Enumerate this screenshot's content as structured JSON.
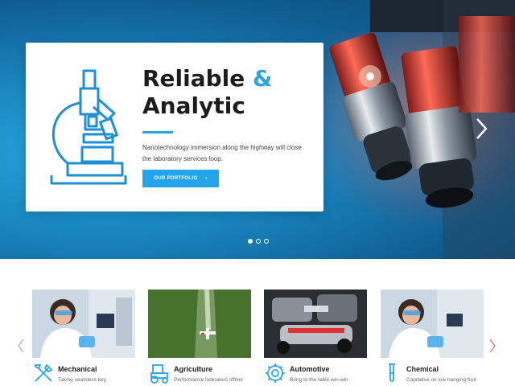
{
  "hero": {
    "title_line1": "Reliable",
    "title_amp": "&",
    "title_line2": "Analytic",
    "text": "Nanotechnology immersion along the highway will close the laboratory services loop.",
    "button_label": "OUR PORTFOLIO",
    "button_arrow": "›",
    "next_arrow": "›",
    "slides_count": 3,
    "active_slide": 1,
    "accent_color": "#2ba4e0"
  },
  "services": {
    "prev_arrow": "‹",
    "next_arrow": "›",
    "items": [
      {
        "name": "Mechanical",
        "desc": "Taking seamless key",
        "icon": "tools-icon"
      },
      {
        "name": "Agriculture",
        "desc": "Performance indicators offline",
        "icon": "tractor-icon"
      },
      {
        "name": "Automotive",
        "desc": "Bring to the table win-win",
        "icon": "gear-icon"
      },
      {
        "name": "Chemical",
        "desc": "Capitalise on low hanging fruit",
        "icon": "test-tube-icon"
      }
    ]
  }
}
